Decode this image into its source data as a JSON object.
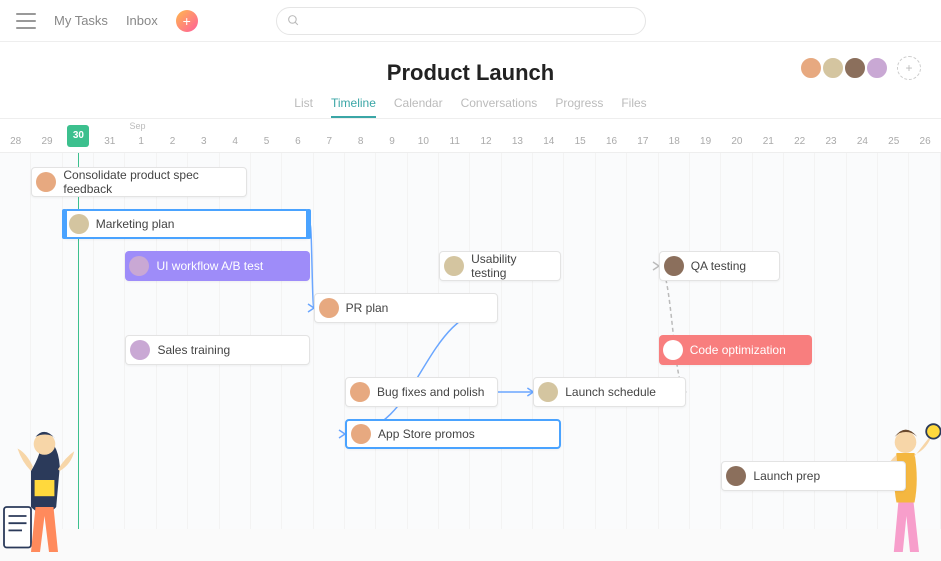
{
  "nav": {
    "my_tasks": "My Tasks",
    "inbox": "Inbox"
  },
  "page": {
    "title": "Product Launch"
  },
  "tabs": [
    "List",
    "Timeline",
    "Calendar",
    "Conversations",
    "Progress",
    "Files"
  ],
  "active_tab": 1,
  "members": [
    {
      "color": "#e7a980"
    },
    {
      "color": "#d4c5a0"
    },
    {
      "color": "#8b6f5c"
    },
    {
      "color": "#c9a8d4"
    }
  ],
  "timeline": {
    "month_label": "Sep",
    "month_label_at": 4,
    "days": [
      28,
      29,
      30,
      31,
      1,
      2,
      3,
      4,
      5,
      6,
      7,
      8,
      9,
      10,
      11,
      12,
      13,
      14,
      15,
      16,
      17,
      18,
      19,
      20,
      21,
      22,
      23,
      24,
      25,
      26
    ],
    "today_index": 2
  },
  "tasks": [
    {
      "id": "t1",
      "label": "Consolidate product spec feedback",
      "start": 1,
      "span": 7,
      "row": 0,
      "style": "white",
      "avatar": "#e7a980"
    },
    {
      "id": "t2",
      "label": "Marketing plan",
      "start": 2,
      "span": 8,
      "row": 1,
      "style": "blue",
      "avatar": "#d4c5a0"
    },
    {
      "id": "t3",
      "label": "UI workflow A/B test",
      "start": 4,
      "span": 6,
      "row": 2,
      "style": "purple",
      "avatar": "#c9a8d4"
    },
    {
      "id": "t4",
      "label": "Usability testing",
      "start": 14,
      "span": 4,
      "row": 2,
      "style": "white",
      "avatar": "#d4c5a0"
    },
    {
      "id": "t5",
      "label": "QA testing",
      "start": 21,
      "span": 4,
      "row": 2,
      "style": "white",
      "avatar": "#8b6f5c"
    },
    {
      "id": "t6",
      "label": "PR plan",
      "start": 10,
      "span": 6,
      "row": 3,
      "style": "white",
      "avatar": "#e7a980"
    },
    {
      "id": "t7",
      "label": "Sales training",
      "start": 4,
      "span": 6,
      "row": 4,
      "style": "white",
      "avatar": "#c9a8d4"
    },
    {
      "id": "t8",
      "label": "Code optimization",
      "start": 21,
      "span": 5,
      "row": 4,
      "style": "coral",
      "avatar": "#fff"
    },
    {
      "id": "t9",
      "label": "Bug fixes and polish",
      "start": 11,
      "span": 5,
      "row": 5,
      "style": "white",
      "avatar": "#e7a980"
    },
    {
      "id": "t10",
      "label": "Launch schedule",
      "start": 17,
      "span": 5,
      "row": 5,
      "style": "white",
      "avatar": "#d4c5a0"
    },
    {
      "id": "t11",
      "label": "App Store promos",
      "start": 11,
      "span": 7,
      "row": 6,
      "style": "blue2",
      "avatar": "#e7a980"
    },
    {
      "id": "t12",
      "label": "Launch prep",
      "start": 23,
      "span": 6,
      "row": 7,
      "style": "white",
      "avatar": "#8b6f5c"
    }
  ],
  "connectors": [
    {
      "from": "t2",
      "to": "t6"
    },
    {
      "from": "t6",
      "to": "t11"
    },
    {
      "from": "t9",
      "to": "t10"
    },
    {
      "from": "t10",
      "to": "t5"
    }
  ],
  "chart_data": {
    "type": "gantt",
    "title": "Product Launch",
    "x_unit": "day",
    "x_range_labels": [
      "Aug 28",
      "Sep 26"
    ],
    "today": "Aug 30",
    "series": [
      {
        "name": "Consolidate product spec feedback",
        "start": "Aug 29",
        "end": "Sep 4"
      },
      {
        "name": "Marketing plan",
        "start": "Aug 30",
        "end": "Sep 6"
      },
      {
        "name": "UI workflow A/B test",
        "start": "Sep 1",
        "end": "Sep 6"
      },
      {
        "name": "Usability testing",
        "start": "Sep 11",
        "end": "Sep 14"
      },
      {
        "name": "QA testing",
        "start": "Sep 18",
        "end": "Sep 21"
      },
      {
        "name": "PR plan",
        "start": "Sep 7",
        "end": "Sep 12"
      },
      {
        "name": "Sales training",
        "start": "Sep 1",
        "end": "Sep 6"
      },
      {
        "name": "Code optimization",
        "start": "Sep 18",
        "end": "Sep 22"
      },
      {
        "name": "Bug fixes and polish",
        "start": "Sep 8",
        "end": "Sep 12"
      },
      {
        "name": "Launch schedule",
        "start": "Sep 14",
        "end": "Sep 18"
      },
      {
        "name": "App Store promos",
        "start": "Sep 8",
        "end": "Sep 14"
      },
      {
        "name": "Launch prep",
        "start": "Sep 20",
        "end": "Sep 25"
      }
    ],
    "dependencies": [
      [
        "Marketing plan",
        "PR plan"
      ],
      [
        "PR plan",
        "App Store promos"
      ],
      [
        "Bug fixes and polish",
        "Launch schedule"
      ],
      [
        "Launch schedule",
        "QA testing"
      ]
    ]
  }
}
